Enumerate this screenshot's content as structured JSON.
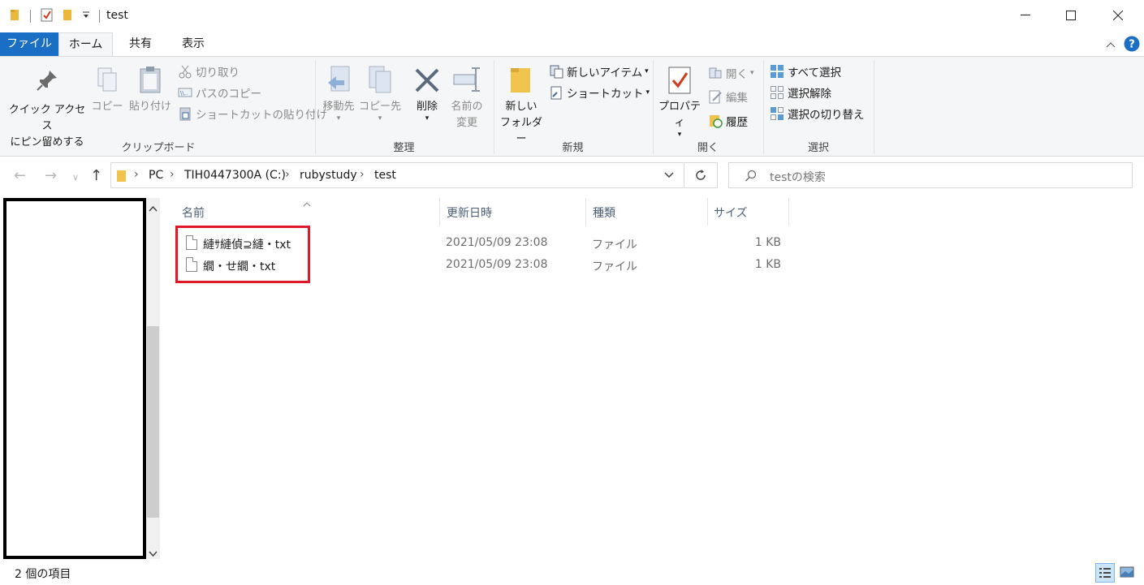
{
  "window": {
    "title": "test",
    "minimize": "—",
    "maximize": "☐",
    "close": "✕"
  },
  "tabs": [
    {
      "label": "ファイル"
    },
    {
      "label": "ホーム"
    },
    {
      "label": "共有"
    },
    {
      "label": "表示"
    }
  ],
  "ribbon": {
    "clipboard": {
      "pin_label_1": "クイック アクセス",
      "pin_label_2": "にピン留めする",
      "copy": "コピー",
      "paste": "貼り付け",
      "cut": "切り取り",
      "copy_path": "パスのコピー",
      "paste_shortcut": "ショートカットの貼り付け",
      "group": "クリップボード"
    },
    "organize": {
      "move_to": "移動先",
      "copy_to": "コピー先",
      "delete": "削除",
      "rename_1": "名前の",
      "rename_2": "変更",
      "group": "整理"
    },
    "new": {
      "new_folder_1": "新しい",
      "new_folder_2": "フォルダー",
      "new_item": "新しいアイテム",
      "shortcut": "ショートカット",
      "group": "新規"
    },
    "open": {
      "properties": "プロパティ",
      "open": "開く",
      "edit": "編集",
      "history": "履歴",
      "group": "開く"
    },
    "select": {
      "select_all": "すべて選択",
      "select_none": "選択解除",
      "invert": "選択の切り替え",
      "group": "選択"
    }
  },
  "address": {
    "crumbs": [
      "PC",
      "TIH0447300A (C:)",
      "rubystudy",
      "test"
    ],
    "search_placeholder": "testの検索"
  },
  "columns": {
    "name": "名前",
    "modified": "更新日時",
    "type": "種類",
    "size": "サイズ"
  },
  "files": [
    {
      "name": "縺ｻ縺偵⊇縺・txt",
      "modified": "2021/05/09 23:08",
      "type": "ファイル",
      "size": "1 KB"
    },
    {
      "name": "繝・せ繝・txt",
      "modified": "2021/05/09 23:08",
      "type": "ファイル",
      "size": "1 KB"
    }
  ],
  "status": {
    "item_count": "2 個の項目"
  },
  "colors": {
    "file_tab": "#1a6fc4",
    "highlight_box": "#e0162b",
    "ribbon_bg": "#f5f6f7"
  }
}
